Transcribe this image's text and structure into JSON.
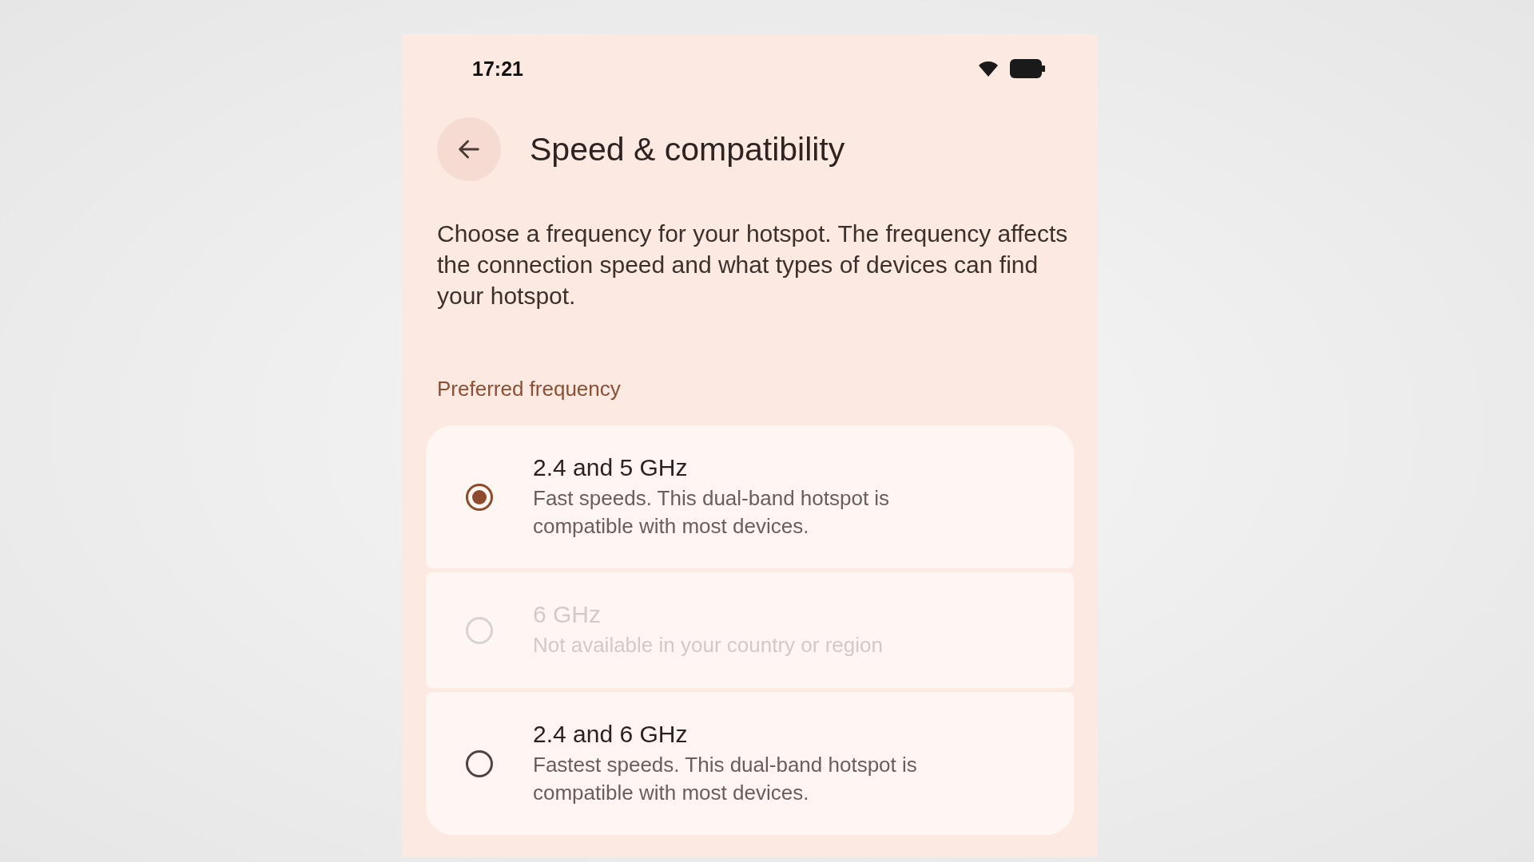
{
  "status_bar": {
    "time": "17:21"
  },
  "header": {
    "title": "Speed & compatibility"
  },
  "description": "Choose a frequency for your hotspot. The frequency affects the connection speed and what types of devices can find your hotspot.",
  "section": {
    "label": "Preferred frequency"
  },
  "options": [
    {
      "title": "2.4 and 5 GHz",
      "summary": "Fast speeds. This dual-band hotspot is compatible with most devices.",
      "selected": true,
      "disabled": false
    },
    {
      "title": "6 GHz",
      "summary": "Not available in your country or region",
      "selected": false,
      "disabled": true
    },
    {
      "title": "2.4 and 6 GHz",
      "summary": "Fastest speeds. This dual-band hotspot is compatible with most devices.",
      "selected": false,
      "disabled": false
    }
  ]
}
